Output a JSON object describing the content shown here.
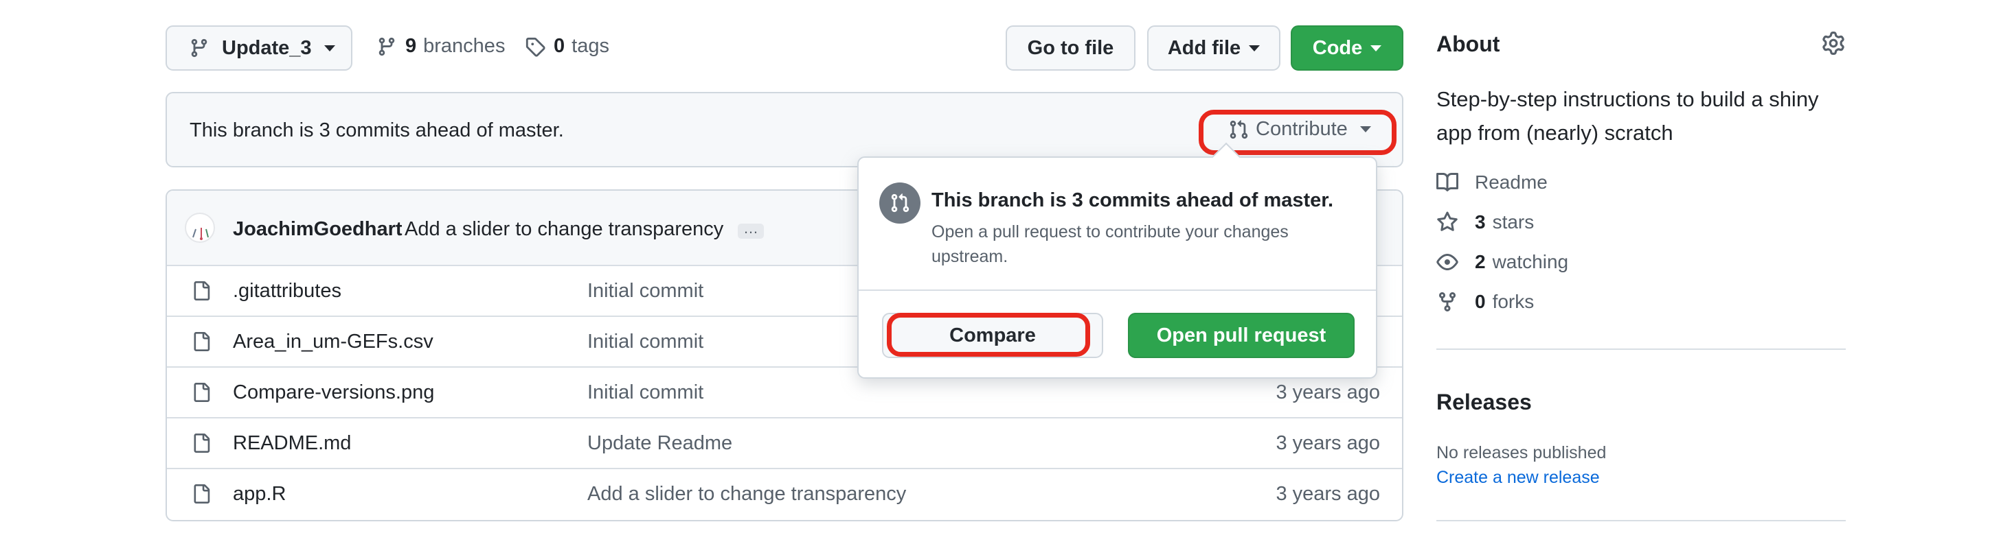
{
  "toolbar": {
    "branch": "Update_3",
    "branches_count": "9",
    "branches_label": "branches",
    "tags_count": "0",
    "tags_label": "tags",
    "go_to_file": "Go to file",
    "add_file": "Add file",
    "code": "Code"
  },
  "banner": {
    "text": "This branch is 3 commits ahead of master.",
    "contribute": "Contribute"
  },
  "commit": {
    "author": "JoachimGoedhart",
    "message": "Add a slider to change transparency",
    "ellipsis": "…"
  },
  "files": [
    {
      "name": ".gitattributes",
      "message": "Initial commit",
      "age": ""
    },
    {
      "name": "Area_in_um-GEFs.csv",
      "message": "Initial commit",
      "age": ""
    },
    {
      "name": "Compare-versions.png",
      "message": "Initial commit",
      "age": "3 years ago"
    },
    {
      "name": "README.md",
      "message": "Update Readme",
      "age": "3 years ago"
    },
    {
      "name": "app.R",
      "message": "Add a slider to change transparency",
      "age": "3 years ago"
    }
  ],
  "popover": {
    "title": "This branch is 3 commits ahead of master.",
    "description": "Open a pull request to contribute your changes upstream.",
    "compare": "Compare",
    "open_pr": "Open pull request"
  },
  "about": {
    "heading": "About",
    "description": "Step-by-step instructions to build a shiny app from (nearly) scratch",
    "readme": "Readme",
    "stars_count": "3",
    "stars_label": "stars",
    "watching_count": "2",
    "watching_label": "watching",
    "forks_count": "0",
    "forks_label": "forks"
  },
  "releases": {
    "heading": "Releases",
    "none": "No releases published",
    "create": "Create a new release"
  },
  "colors": {
    "green": "#2da44e",
    "highlight": "#e8281d",
    "link": "#0969da"
  }
}
